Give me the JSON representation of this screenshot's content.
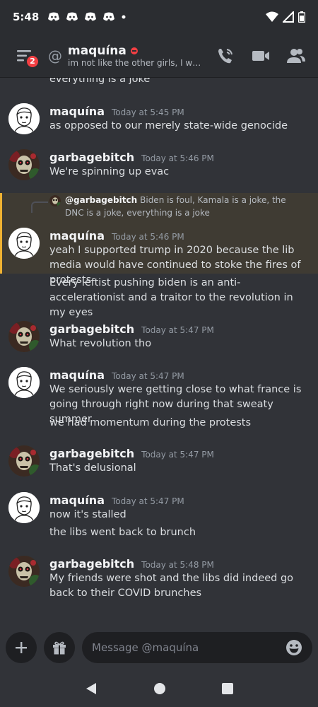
{
  "status_bar": {
    "time": "5:48"
  },
  "header": {
    "badge_count": "2",
    "title": "maquína",
    "status_text": "im not like the other girls, I we..."
  },
  "messages": [
    {
      "author": "",
      "time": "",
      "text": "everything is a joke"
    },
    {
      "author": "maquína",
      "time": "Today at 5:45 PM",
      "text": "as opposed to our merely state-wide genocide"
    },
    {
      "author": "garbagebitch",
      "time": "Today at 5:46 PM",
      "text": "We're spinning up evac"
    },
    {
      "author": "maquína",
      "time": "Today at 5:46 PM",
      "text": "yeah I supported trump in 2020 because the lib media would have continued to stoke the fires of protests",
      "reply_author": "@garbagebitch",
      "reply_text": "Biden is foul, Kamala is a joke, the DNC is a joke, everything is a joke"
    },
    {
      "author": "",
      "time": "",
      "text": "Every leftist pushing biden is an anti-accelerationist and a traitor to the revolution in my eyes"
    },
    {
      "author": "garbagebitch",
      "time": "Today at 5:47 PM",
      "text": "What revolution tho"
    },
    {
      "author": "maquína",
      "time": "Today at 5:47 PM",
      "text": "We seriously were getting close to what france is going through right now during that sweaty summer"
    },
    {
      "author": "",
      "time": "",
      "text": "we had momentum during the protests"
    },
    {
      "author": "garbagebitch",
      "time": "Today at 5:47 PM",
      "text": "That's delusional"
    },
    {
      "author": "maquína",
      "time": "Today at 5:47 PM",
      "text": "now it's stalled"
    },
    {
      "author": "",
      "time": "",
      "text": "the libs went back to brunch"
    },
    {
      "author": "garbagebitch",
      "time": "Today at 5:48 PM",
      "text": "My friends were shot and the libs did indeed go back to their COVID brunches"
    }
  ],
  "input": {
    "placeholder": "Message @maquína"
  },
  "colors": {
    "background": "#313338",
    "header": "#2b2d31",
    "highlight": "#3f3b33",
    "highlight_bar": "#f0b232",
    "dnd": "#f23f43"
  }
}
